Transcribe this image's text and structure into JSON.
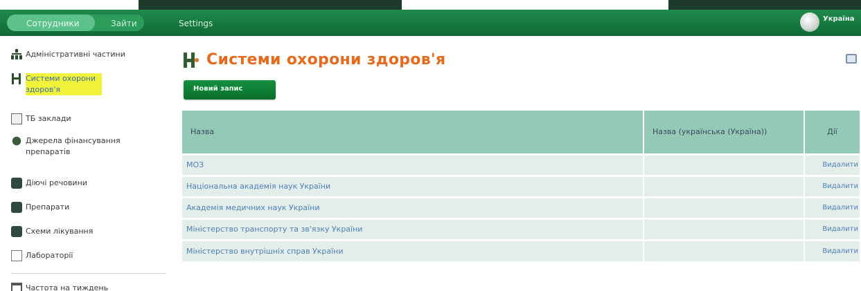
{
  "topnav": {
    "tab_active": "Сотрудники",
    "tab_login": "Зайти",
    "settings": "Settings",
    "language": "Україна"
  },
  "sidebar": {
    "items": [
      {
        "label": "Адміністративні частини",
        "icon": "org-chart-icon"
      },
      {
        "label": "Системи охорони здоров'я",
        "icon": "health-system-icon",
        "selected": true
      },
      {
        "label": "ТБ заклади",
        "icon": "document-icon"
      },
      {
        "label": "Джерела фінансування препаратів",
        "icon": "funding-icon"
      },
      {
        "label": "Діючі речовини",
        "icon": "substance-icon"
      },
      {
        "label": "Препарати",
        "icon": "drug-icon"
      },
      {
        "label": "Схеми лікування",
        "icon": "regimen-icon"
      },
      {
        "label": "Лабораторії",
        "icon": "lab-icon"
      },
      {
        "label": "Частота на тиждень",
        "icon": "calendar-icon"
      }
    ]
  },
  "main": {
    "title": "Системи охорони здоров'я",
    "new_button": "Новий запис"
  },
  "table": {
    "columns": [
      "Назва",
      "Назва (українська (Україна))",
      "Дії"
    ],
    "rows": [
      {
        "name": "МОЗ",
        "name_ua": "",
        "action": "Видалити"
      },
      {
        "name": "Національна академія наук України",
        "name_ua": "",
        "action": "Видалити"
      },
      {
        "name": "Академія медичних наук України",
        "name_ua": "",
        "action": "Видалити"
      },
      {
        "name": "Міністерство транспорту та зв'язку України",
        "name_ua": "",
        "action": "Видалити"
      },
      {
        "name": "Міністерство внутрішніх справ України",
        "name_ua": "",
        "action": "Видалити"
      }
    ]
  },
  "colors": {
    "topbar": "#15803f",
    "title": "#e56a1c",
    "table_header": "#94c8b7",
    "table_row": "#e3eeea",
    "link": "#4d7fb8",
    "selection_highlight": "#f1f23a"
  }
}
